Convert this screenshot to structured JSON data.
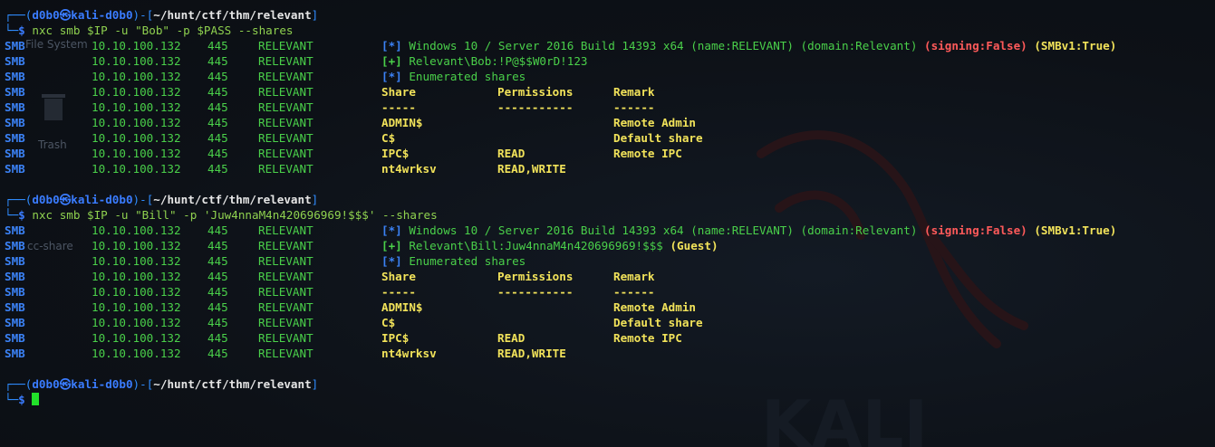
{
  "prompt": {
    "user": "d0b0",
    "at": "㉿",
    "host": "kali-d0b0",
    "path": "~/hunt/ctf/thm/relevant"
  },
  "desktop": {
    "icon1": "File System",
    "icon2": "Trash",
    "icon3": "cc-share"
  },
  "blocks": [
    {
      "command": "nxc smb $IP -u \"Bob\" -p $PASS --shares",
      "lines": [
        {
          "proto": "SMB",
          "ip": "10.10.100.132",
          "port": "445",
          "host": "RELEVANT",
          "type": "info",
          "text": "Windows 10 / Server 2016 Build 14393 x64 (name:RELEVANT) (domain:Relevant) ",
          "signing": "(signing:False)",
          "smbv1": "(SMBv1:True)"
        },
        {
          "proto": "SMB",
          "ip": "10.10.100.132",
          "port": "445",
          "host": "RELEVANT",
          "type": "plus",
          "text": "Relevant\\Bob:!P@$$W0rD!123",
          "extra": ""
        },
        {
          "proto": "SMB",
          "ip": "10.10.100.132",
          "port": "445",
          "host": "RELEVANT",
          "type": "star",
          "text": "Enumerated shares"
        },
        {
          "proto": "SMB",
          "ip": "10.10.100.132",
          "port": "445",
          "host": "RELEVANT",
          "type": "table",
          "share": "Share",
          "perm": "Permissions",
          "remark": "Remark"
        },
        {
          "proto": "SMB",
          "ip": "10.10.100.132",
          "port": "445",
          "host": "RELEVANT",
          "type": "table",
          "share": "-----",
          "perm": "-----------",
          "remark": "------"
        },
        {
          "proto": "SMB",
          "ip": "10.10.100.132",
          "port": "445",
          "host": "RELEVANT",
          "type": "table",
          "share": "ADMIN$",
          "perm": "",
          "remark": "Remote Admin"
        },
        {
          "proto": "SMB",
          "ip": "10.10.100.132",
          "port": "445",
          "host": "RELEVANT",
          "type": "table",
          "share": "C$",
          "perm": "",
          "remark": "Default share"
        },
        {
          "proto": "SMB",
          "ip": "10.10.100.132",
          "port": "445",
          "host": "RELEVANT",
          "type": "table",
          "share": "IPC$",
          "perm": "READ",
          "remark": "Remote IPC"
        },
        {
          "proto": "SMB",
          "ip": "10.10.100.132",
          "port": "445",
          "host": "RELEVANT",
          "type": "table",
          "share": "nt4wrksv",
          "perm": "READ,WRITE",
          "remark": ""
        }
      ]
    },
    {
      "command": "nxc smb $IP -u \"Bill\" -p 'Juw4nnaM4n420696969!$$$' --shares",
      "lines": [
        {
          "proto": "SMB",
          "ip": "10.10.100.132",
          "port": "445",
          "host": "RELEVANT",
          "type": "info",
          "text": "Windows 10 / Server 2016 Build 14393 x64 (name:RELEVANT) (domain:Relevant) ",
          "signing": "(signing:False)",
          "smbv1": "(SMBv1:True)"
        },
        {
          "proto": "SMB",
          "ip": "10.10.100.132",
          "port": "445",
          "host": "RELEVANT",
          "type": "plus",
          "text": "Relevant\\Bill:Juw4nnaM4n420696969!$$$ ",
          "extra": "(Guest)"
        },
        {
          "proto": "SMB",
          "ip": "10.10.100.132",
          "port": "445",
          "host": "RELEVANT",
          "type": "star",
          "text": "Enumerated shares"
        },
        {
          "proto": "SMB",
          "ip": "10.10.100.132",
          "port": "445",
          "host": "RELEVANT",
          "type": "table",
          "share": "Share",
          "perm": "Permissions",
          "remark": "Remark"
        },
        {
          "proto": "SMB",
          "ip": "10.10.100.132",
          "port": "445",
          "host": "RELEVANT",
          "type": "table",
          "share": "-----",
          "perm": "-----------",
          "remark": "------"
        },
        {
          "proto": "SMB",
          "ip": "10.10.100.132",
          "port": "445",
          "host": "RELEVANT",
          "type": "table",
          "share": "ADMIN$",
          "perm": "",
          "remark": "Remote Admin"
        },
        {
          "proto": "SMB",
          "ip": "10.10.100.132",
          "port": "445",
          "host": "RELEVANT",
          "type": "table",
          "share": "C$",
          "perm": "",
          "remark": "Default share"
        },
        {
          "proto": "SMB",
          "ip": "10.10.100.132",
          "port": "445",
          "host": "RELEVANT",
          "type": "table",
          "share": "IPC$",
          "perm": "READ",
          "remark": "Remote IPC"
        },
        {
          "proto": "SMB",
          "ip": "10.10.100.132",
          "port": "445",
          "host": "RELEVANT",
          "type": "table",
          "share": "nt4wrksv",
          "perm": "READ,WRITE",
          "remark": ""
        }
      ]
    }
  ],
  "final_prompt": {
    "command": ""
  },
  "marks": {
    "star": "[*]",
    "plus": "[+]",
    "corner_top": "┌──",
    "corner_bot": "└─",
    "dollar": "$"
  },
  "colors": {
    "accent": "#3b82f6",
    "ok": "#4ad04a",
    "warn": "#ff5a5a",
    "highlight": "#f2e35a",
    "cursor": "#22e02a"
  }
}
